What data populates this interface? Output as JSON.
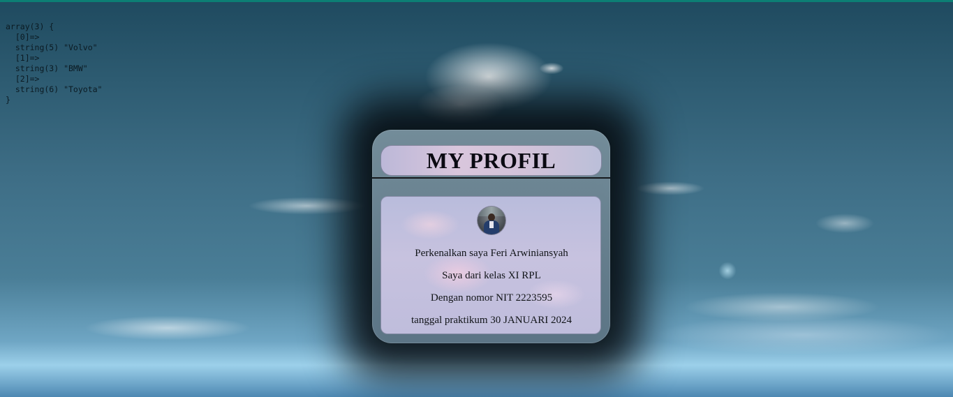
{
  "debug_output": "array(3) {\n  [0]=>\n  string(5) \"Volvo\"\n  [1]=>\n  string(3) \"BMW\"\n  [2]=>\n  string(6) \"Toyota\"\n}",
  "profile": {
    "title": "MY PROFIL",
    "avatar_alt": "profile photo",
    "lines": [
      "Perkenalkan saya Feri Arwiniansyah",
      "Saya dari kelas XI RPL",
      "Dengan nomor NIT 2223595",
      "tanggal praktikum 30 JANUARI 2024"
    ]
  },
  "colors": {
    "top_bar": "#0c7f74",
    "title_text": "#0a0a12",
    "body_text": "#111418"
  }
}
